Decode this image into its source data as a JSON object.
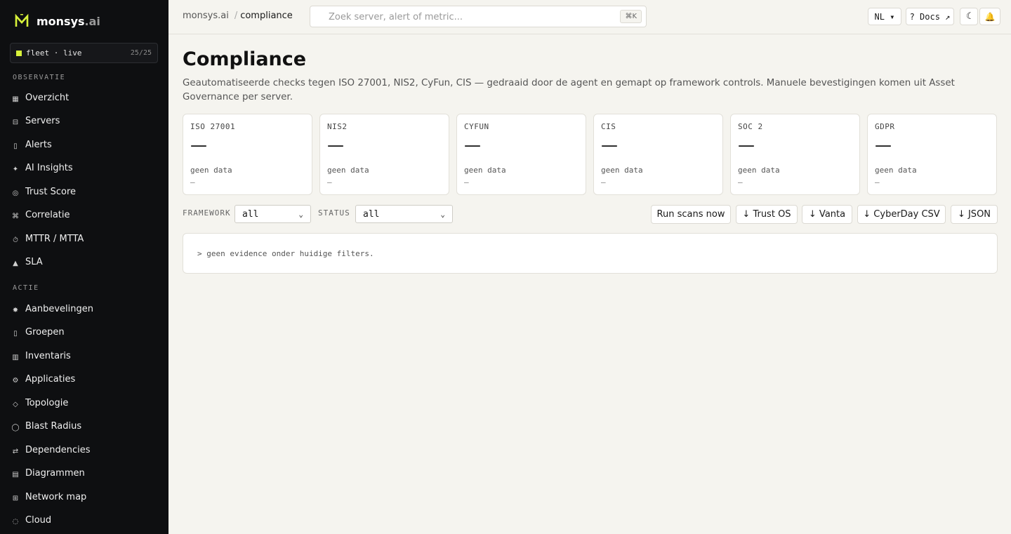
{
  "brand": {
    "name": "monsys",
    "tld": ".ai"
  },
  "fleet": {
    "label": "fleet · live",
    "count": "25/25",
    "status_color": "#d8f23a"
  },
  "sidebar": {
    "sections": [
      {
        "heading": "OBSERVATIE"
      },
      {
        "heading": "ACTIE"
      }
    ],
    "items": [
      {
        "label": "Overzicht",
        "icon": "▦"
      },
      {
        "label": "Servers",
        "icon": "⊟"
      },
      {
        "label": "Alerts",
        "icon": "▯"
      },
      {
        "label": "AI Insights",
        "icon": "✦"
      },
      {
        "label": "Trust Score",
        "icon": "◎"
      },
      {
        "label": "Correlatie",
        "icon": "⌘"
      },
      {
        "label": "MTTR / MTTA",
        "icon": "⏱"
      },
      {
        "label": "SLA",
        "icon": "▲"
      },
      {
        "label": "Aanbevelingen",
        "icon": "✸"
      },
      {
        "label": "Groepen",
        "icon": "▯"
      },
      {
        "label": "Inventaris",
        "icon": "▥"
      },
      {
        "label": "Applicaties",
        "icon": "⚙"
      },
      {
        "label": "Topologie",
        "icon": "◇"
      },
      {
        "label": "Blast Radius",
        "icon": "◯"
      },
      {
        "label": "Dependencies",
        "icon": "⇄"
      },
      {
        "label": "Diagrammen",
        "icon": "▤"
      },
      {
        "label": "Network map",
        "icon": "⊞"
      },
      {
        "label": "Cloud",
        "icon": "◌"
      }
    ]
  },
  "topbar": {
    "breadcrumb_root": "monsys.ai",
    "breadcrumb_sep": "/",
    "breadcrumb_current": "compliance",
    "search_placeholder": "Zoek server, alert of metric...",
    "search_shortcut": "⌘K",
    "lang": "NL ▾",
    "docs": "? Docs ↗",
    "theme_icon": "☾",
    "bell_icon": "🔔"
  },
  "page": {
    "title": "Compliance",
    "description": "Geautomatiseerde checks tegen ISO 27001, NIS2, CyFun, CIS — gedraaid door de agent en gemapt op framework controls. Manuele bevestigingen komen uit Asset Governance per server."
  },
  "frameworks": [
    {
      "name": "ISO 27001",
      "value": "—",
      "sub": "geen data",
      "foot": "–"
    },
    {
      "name": "NIS2",
      "value": "—",
      "sub": "geen data",
      "foot": "–"
    },
    {
      "name": "CYFUN",
      "value": "—",
      "sub": "geen data",
      "foot": "–"
    },
    {
      "name": "CIS",
      "value": "—",
      "sub": "geen data",
      "foot": "–"
    },
    {
      "name": "SOC 2",
      "value": "—",
      "sub": "geen data",
      "foot": "–"
    },
    {
      "name": "GDPR",
      "value": "—",
      "sub": "geen data",
      "foot": "–"
    }
  ],
  "filters": {
    "framework_label": "FRAMEWORK",
    "framework_value": "all",
    "status_label": "STATUS",
    "status_value": "all"
  },
  "actions": {
    "run": "Run scans now",
    "trust_os": "↓ Trust OS",
    "vanta": "↓ Vanta",
    "cyberday": "↓ CyberDay CSV",
    "json": "↓ JSON"
  },
  "evidence": {
    "empty": "> geen evidence onder huidige filters."
  }
}
